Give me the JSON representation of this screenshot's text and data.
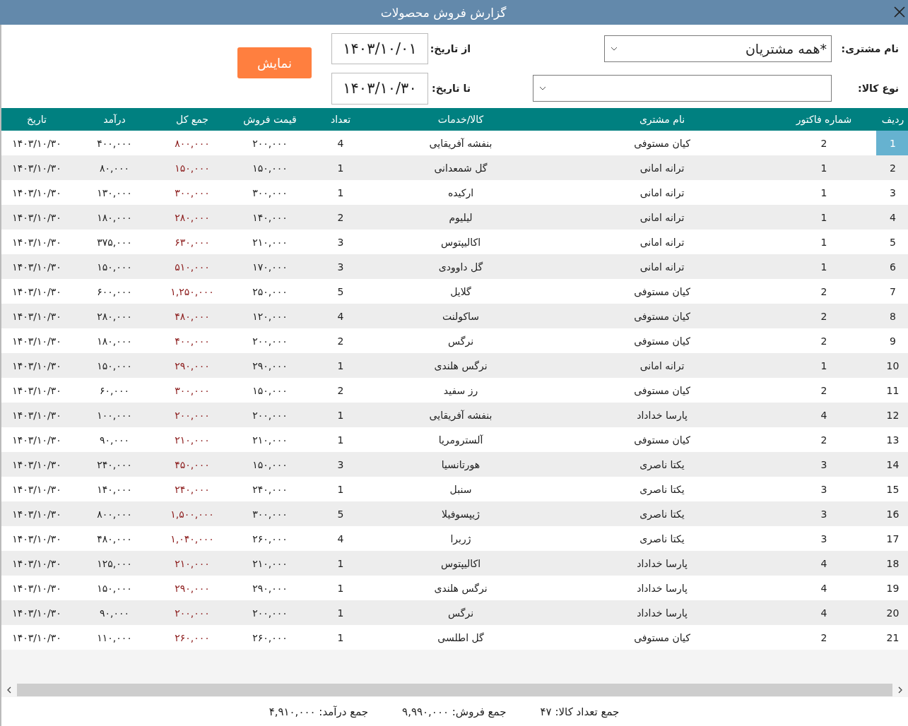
{
  "window": {
    "title": "گزارش فروش محصولات"
  },
  "filters": {
    "customer": {
      "label": "نام مشتری:",
      "value": "*همه مشتریان"
    },
    "product_type": {
      "label": "نوع کالا:"
    },
    "from_date": {
      "label": "از تاریخ:",
      "value": "۱۴۰۳/۱۰/۰۱"
    },
    "to_date": {
      "label": "تا تاریخ:",
      "value": "۱۴۰۳/۱۰/۳۰"
    },
    "show_button": "نمایش"
  },
  "table": {
    "columns": [
      "ردیف",
      "شماره فاکتور",
      "نام مشتری",
      "کالا/خدمات",
      "تعداد",
      "قیمت فروش",
      "جمع کل",
      "درآمد",
      "تاریخ"
    ],
    "rows": [
      {
        "selected": true,
        "cells": [
          "1",
          "2",
          "کیان مستوفی",
          "بنفشه آفریقایی",
          "4",
          "۲۰۰,۰۰۰",
          "۸۰۰,۰۰۰",
          "۴۰۰,۰۰۰",
          "۱۴۰۳/۱۰/۳۰"
        ]
      },
      {
        "selected": false,
        "cells": [
          "2",
          "1",
          "ترانه امانی",
          "گل شمعدانی",
          "1",
          "۱۵۰,۰۰۰",
          "۱۵۰,۰۰۰",
          "۸۰,۰۰۰",
          "۱۴۰۳/۱۰/۳۰"
        ]
      },
      {
        "selected": false,
        "cells": [
          "3",
          "1",
          "ترانه امانی",
          "ارکیده",
          "1",
          "۳۰۰,۰۰۰",
          "۳۰۰,۰۰۰",
          "۱۳۰,۰۰۰",
          "۱۴۰۳/۱۰/۳۰"
        ]
      },
      {
        "selected": false,
        "cells": [
          "4",
          "1",
          "ترانه امانی",
          "لیلیوم",
          "2",
          "۱۴۰,۰۰۰",
          "۲۸۰,۰۰۰",
          "۱۸۰,۰۰۰",
          "۱۴۰۳/۱۰/۳۰"
        ]
      },
      {
        "selected": false,
        "cells": [
          "5",
          "1",
          "ترانه امانی",
          "اکالیپتوس",
          "3",
          "۲۱۰,۰۰۰",
          "۶۳۰,۰۰۰",
          "۳۷۵,۰۰۰",
          "۱۴۰۳/۱۰/۳۰"
        ]
      },
      {
        "selected": false,
        "cells": [
          "6",
          "1",
          "ترانه امانی",
          "گل داوودی",
          "3",
          "۱۷۰,۰۰۰",
          "۵۱۰,۰۰۰",
          "۱۵۰,۰۰۰",
          "۱۴۰۳/۱۰/۳۰"
        ]
      },
      {
        "selected": false,
        "cells": [
          "7",
          "2",
          "کیان مستوفی",
          "گلایل",
          "5",
          "۲۵۰,۰۰۰",
          "۱,۲۵۰,۰۰۰",
          "۶۰۰,۰۰۰",
          "۱۴۰۳/۱۰/۳۰"
        ]
      },
      {
        "selected": false,
        "cells": [
          "8",
          "2",
          "کیان مستوفی",
          "ساکولنت",
          "4",
          "۱۲۰,۰۰۰",
          "۴۸۰,۰۰۰",
          "۲۸۰,۰۰۰",
          "۱۴۰۳/۱۰/۳۰"
        ]
      },
      {
        "selected": false,
        "cells": [
          "9",
          "2",
          "کیان مستوفی",
          "نرگس",
          "2",
          "۲۰۰,۰۰۰",
          "۴۰۰,۰۰۰",
          "۱۸۰,۰۰۰",
          "۱۴۰۳/۱۰/۳۰"
        ]
      },
      {
        "selected": false,
        "cells": [
          "10",
          "1",
          "ترانه امانی",
          "نرگس هلندی",
          "1",
          "۲۹۰,۰۰۰",
          "۲۹۰,۰۰۰",
          "۱۵۰,۰۰۰",
          "۱۴۰۳/۱۰/۳۰"
        ]
      },
      {
        "selected": false,
        "cells": [
          "11",
          "2",
          "کیان مستوفی",
          "رز سفید",
          "2",
          "۱۵۰,۰۰۰",
          "۳۰۰,۰۰۰",
          "۶۰,۰۰۰",
          "۱۴۰۳/۱۰/۳۰"
        ]
      },
      {
        "selected": false,
        "cells": [
          "12",
          "4",
          "پارسا خداداد",
          "بنفشه آفریقایی",
          "1",
          "۲۰۰,۰۰۰",
          "۲۰۰,۰۰۰",
          "۱۰۰,۰۰۰",
          "۱۴۰۳/۱۰/۳۰"
        ]
      },
      {
        "selected": false,
        "cells": [
          "13",
          "2",
          "کیان مستوفی",
          "آلسترومریا",
          "1",
          "۲۱۰,۰۰۰",
          "۲۱۰,۰۰۰",
          "۹۰,۰۰۰",
          "۱۴۰۳/۱۰/۳۰"
        ]
      },
      {
        "selected": false,
        "cells": [
          "14",
          "3",
          "یکتا ناصری",
          "هورتانسیا",
          "3",
          "۱۵۰,۰۰۰",
          "۴۵۰,۰۰۰",
          "۲۴۰,۰۰۰",
          "۱۴۰۳/۱۰/۳۰"
        ]
      },
      {
        "selected": false,
        "cells": [
          "15",
          "3",
          "یکتا ناصری",
          "سنبل",
          "1",
          "۲۴۰,۰۰۰",
          "۲۴۰,۰۰۰",
          "۱۴۰,۰۰۰",
          "۱۴۰۳/۱۰/۳۰"
        ]
      },
      {
        "selected": false,
        "cells": [
          "16",
          "3",
          "یکتا ناصری",
          "ژیپسوفیلا",
          "5",
          "۳۰۰,۰۰۰",
          "۱,۵۰۰,۰۰۰",
          "۸۰۰,۰۰۰",
          "۱۴۰۳/۱۰/۳۰"
        ]
      },
      {
        "selected": false,
        "cells": [
          "17",
          "3",
          "یکتا ناصری",
          "ژربرا",
          "4",
          "۲۶۰,۰۰۰",
          "۱,۰۴۰,۰۰۰",
          "۴۸۰,۰۰۰",
          "۱۴۰۳/۱۰/۳۰"
        ]
      },
      {
        "selected": false,
        "cells": [
          "18",
          "4",
          "پارسا خداداد",
          "اکالیپتوس",
          "1",
          "۲۱۰,۰۰۰",
          "۲۱۰,۰۰۰",
          "۱۲۵,۰۰۰",
          "۱۴۰۳/۱۰/۳۰"
        ]
      },
      {
        "selected": false,
        "cells": [
          "19",
          "4",
          "پارسا خداداد",
          "نرگس هلندی",
          "1",
          "۲۹۰,۰۰۰",
          "۲۹۰,۰۰۰",
          "۱۵۰,۰۰۰",
          "۱۴۰۳/۱۰/۳۰"
        ]
      },
      {
        "selected": false,
        "cells": [
          "20",
          "4",
          "پارسا خداداد",
          "نرگس",
          "1",
          "۲۰۰,۰۰۰",
          "۲۰۰,۰۰۰",
          "۹۰,۰۰۰",
          "۱۴۰۳/۱۰/۳۰"
        ]
      },
      {
        "selected": false,
        "cells": [
          "21",
          "2",
          "کیان مستوفی",
          "گل اطلسی",
          "1",
          "۲۶۰,۰۰۰",
          "۲۶۰,۰۰۰",
          "۱۱۰,۰۰۰",
          "۱۴۰۳/۱۰/۳۰"
        ]
      }
    ]
  },
  "totals": [
    "جمع تعداد کالا: ۴۷",
    "جمع فروش: ۹,۹۹۰,۰۰۰",
    "جمع درآمد: ۴,۹۱۰,۰۰۰"
  ]
}
